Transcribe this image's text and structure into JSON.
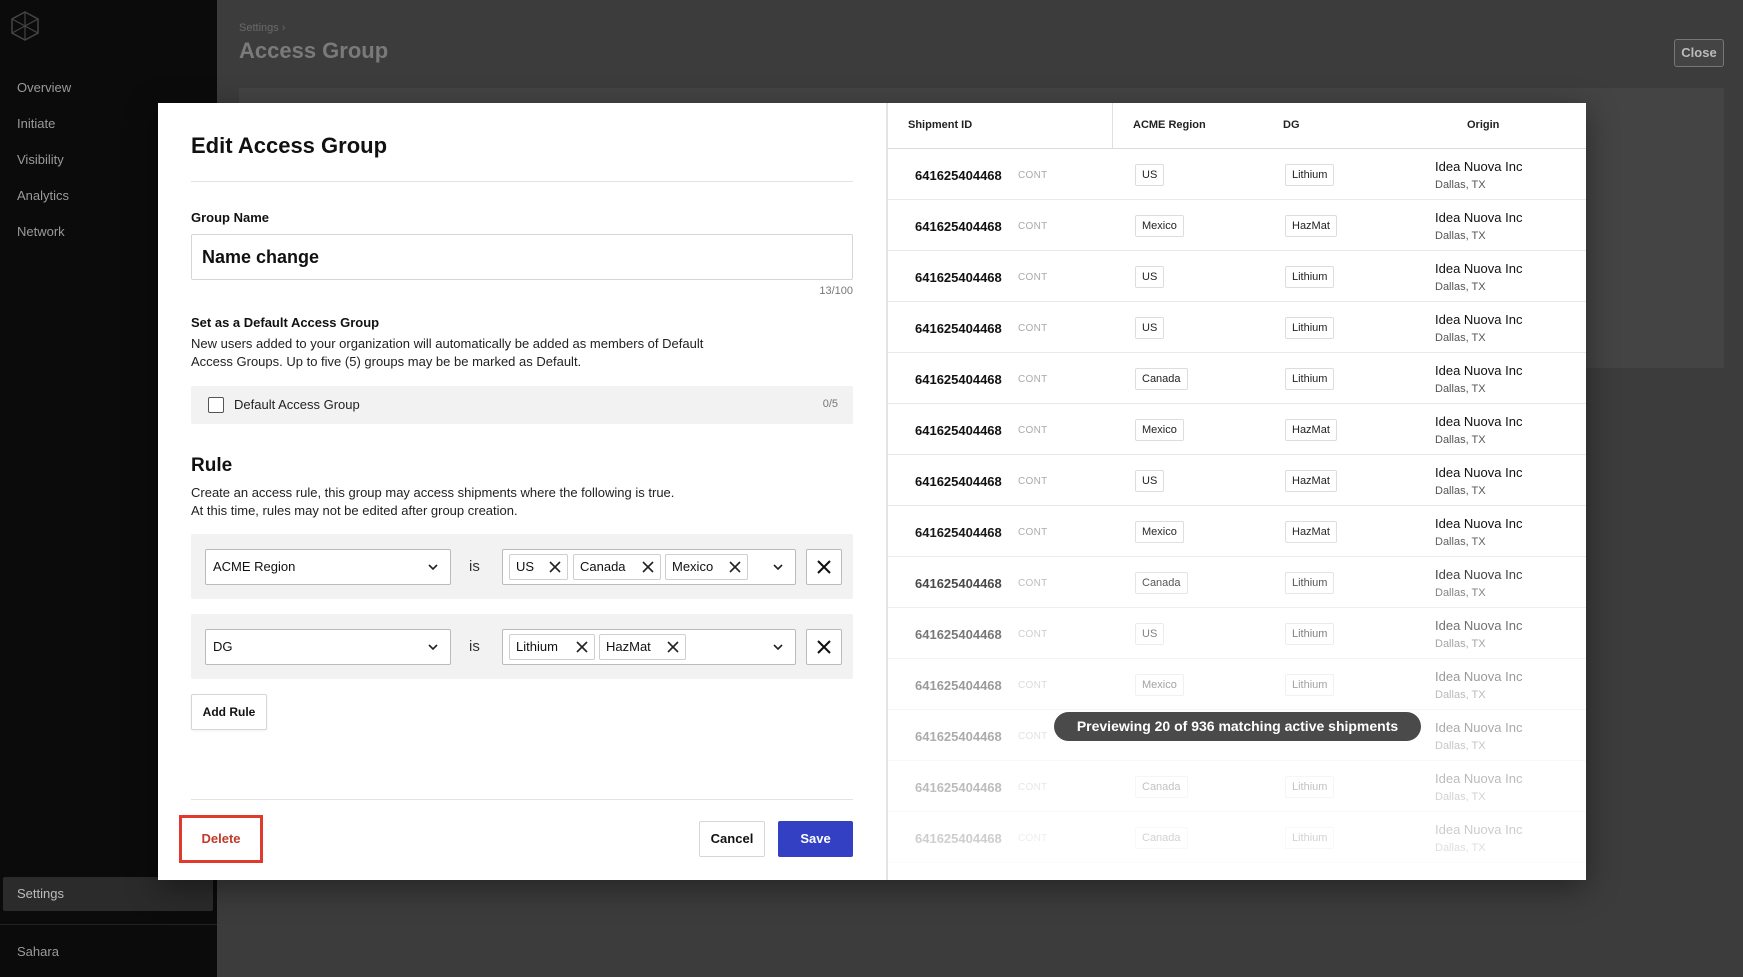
{
  "sidebar": {
    "nav": [
      "Overview",
      "Initiate",
      "Visibility",
      "Analytics",
      "Network"
    ],
    "settings": "Settings",
    "org": "Sahara"
  },
  "page": {
    "breadcrumb": "Settings ›",
    "title": "Access Group",
    "close": "Close"
  },
  "modal": {
    "title": "Edit Access Group",
    "group_name_label": "Group Name",
    "group_name_value": "Name change",
    "char_count": "13/100",
    "default_title": "Set as a Default Access Group",
    "default_desc_1": "New users added to your organization will automatically be added as members of Default",
    "default_desc_2": "Access Groups. Up to five (5) groups may be be marked as Default.",
    "default_checkbox_label": "Default Access Group",
    "default_count": "0/5",
    "rule_title": "Rule",
    "rule_desc_1": "Create an access rule, this group may access shipments where the following is true.",
    "rule_desc_2": "At this time, rules may not be edited after group creation.",
    "rules": [
      {
        "field": "ACME Region",
        "op": "is",
        "values": [
          "US",
          "Canada",
          "Mexico"
        ]
      },
      {
        "field": "DG",
        "op": "is",
        "values": [
          "Lithium",
          "HazMat"
        ]
      }
    ],
    "add_rule": "Add Rule",
    "delete": "Delete",
    "cancel": "Cancel",
    "save": "Save",
    "accent_color": "#3340c4",
    "danger_color": "#e03a2c"
  },
  "table": {
    "headers": [
      "Shipment ID",
      "ACME Region",
      "DG",
      "Origin"
    ],
    "rows": [
      {
        "id": "641625404468",
        "type": "CONT",
        "region": "US",
        "dg": "Lithium",
        "origin": "Idea Nuova Inc",
        "city": "Dallas, TX"
      },
      {
        "id": "641625404468",
        "type": "CONT",
        "region": "Mexico",
        "dg": "HazMat",
        "origin": "Idea Nuova Inc",
        "city": "Dallas, TX"
      },
      {
        "id": "641625404468",
        "type": "CONT",
        "region": "US",
        "dg": "Lithium",
        "origin": "Idea Nuova Inc",
        "city": "Dallas, TX"
      },
      {
        "id": "641625404468",
        "type": "CONT",
        "region": "US",
        "dg": "Lithium",
        "origin": "Idea Nuova Inc",
        "city": "Dallas, TX"
      },
      {
        "id": "641625404468",
        "type": "CONT",
        "region": "Canada",
        "dg": "Lithium",
        "origin": "Idea Nuova Inc",
        "city": "Dallas, TX"
      },
      {
        "id": "641625404468",
        "type": "CONT",
        "region": "Mexico",
        "dg": "HazMat",
        "origin": "Idea Nuova Inc",
        "city": "Dallas, TX"
      },
      {
        "id": "641625404468",
        "type": "CONT",
        "region": "US",
        "dg": "HazMat",
        "origin": "Idea Nuova Inc",
        "city": "Dallas, TX"
      },
      {
        "id": "641625404468",
        "type": "CONT",
        "region": "Mexico",
        "dg": "HazMat",
        "origin": "Idea Nuova Inc",
        "city": "Dallas, TX"
      },
      {
        "id": "641625404468",
        "type": "CONT",
        "region": "Canada",
        "dg": "Lithium",
        "origin": "Idea Nuova Inc",
        "city": "Dallas, TX"
      },
      {
        "id": "641625404468",
        "type": "CONT",
        "region": "US",
        "dg": "Lithium",
        "origin": "Idea Nuova Inc",
        "city": "Dallas, TX"
      },
      {
        "id": "641625404468",
        "type": "CONT",
        "region": "Mexico",
        "dg": "Lithium",
        "origin": "Idea Nuova Inc",
        "city": "Dallas, TX"
      },
      {
        "id": "641625404468",
        "type": "CONT",
        "region": "",
        "dg": "",
        "origin": "Idea Nuova Inc",
        "city": "Dallas, TX"
      },
      {
        "id": "641625404468",
        "type": "CONT",
        "region": "Canada",
        "dg": "Lithium",
        "origin": "Idea Nuova Inc",
        "city": "Dallas, TX"
      },
      {
        "id": "641625404468",
        "type": "CONT",
        "region": "Canada",
        "dg": "Lithium",
        "origin": "Idea Nuova Inc",
        "city": "Dallas, TX"
      }
    ],
    "preview": "Previewing 20 of 936 matching active shipments"
  }
}
